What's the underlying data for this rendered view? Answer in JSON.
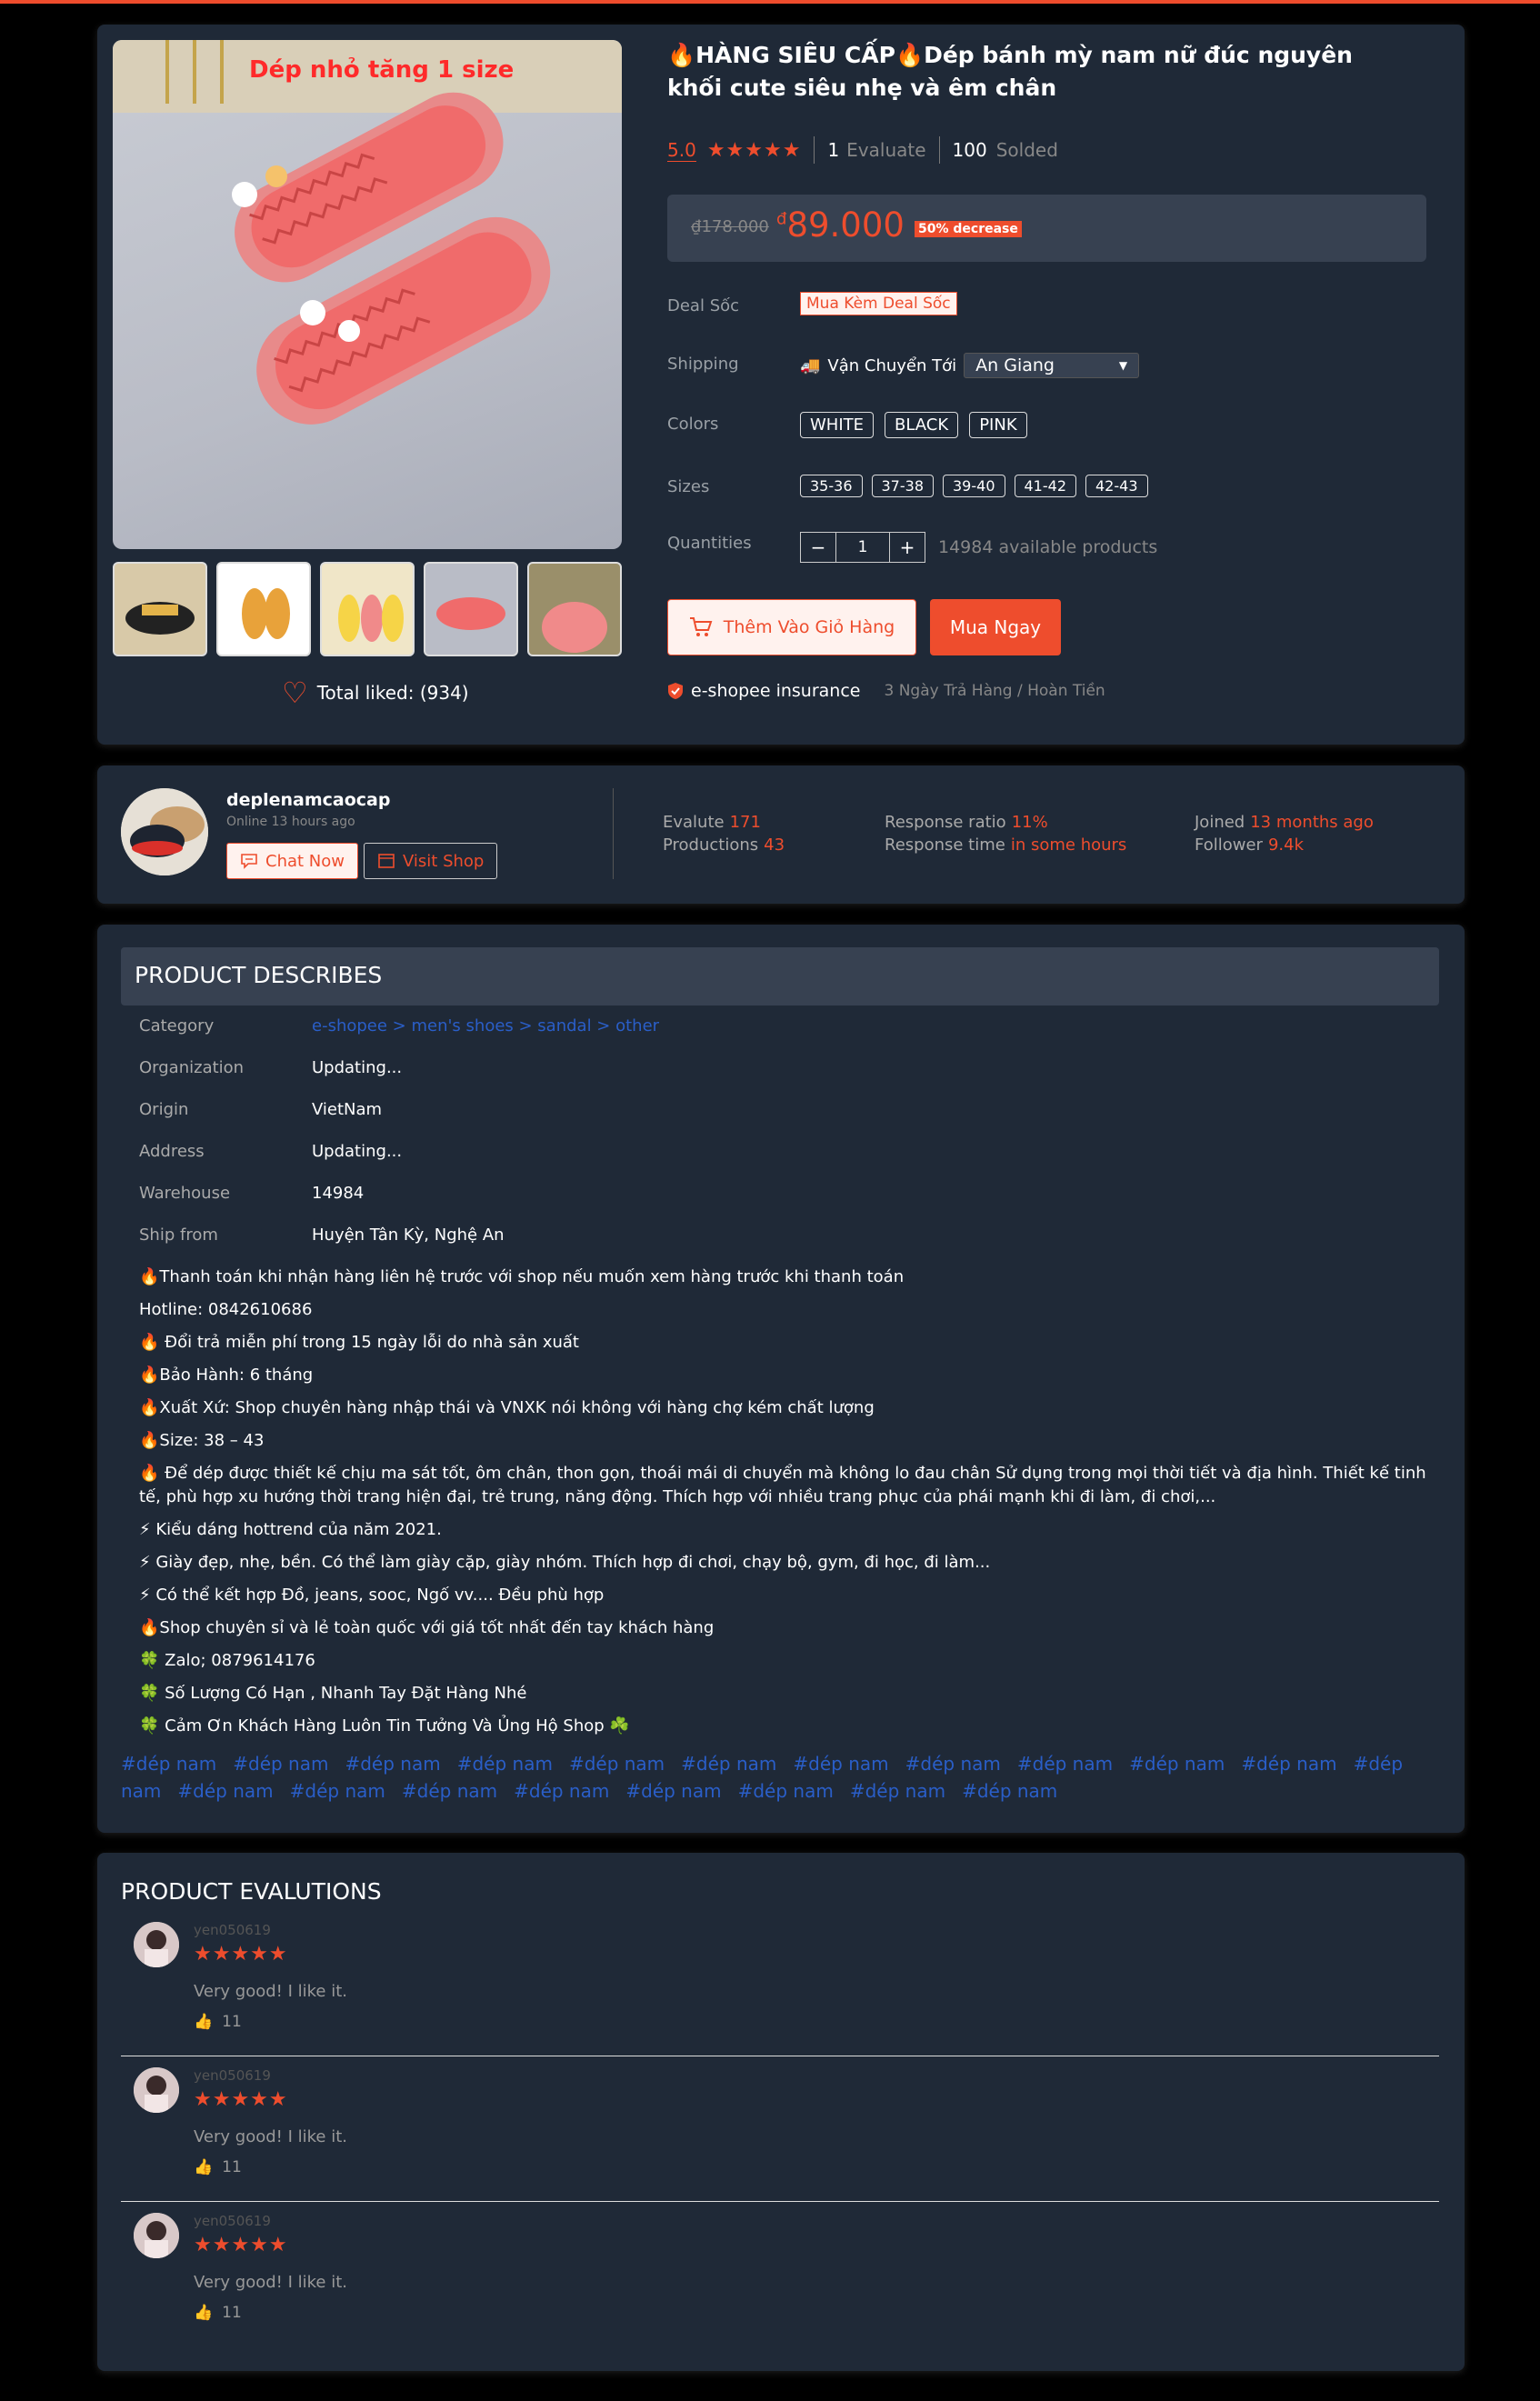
{
  "product": {
    "promo_text": "Dép nhỏ tăng 1 size",
    "liked_label": "Total liked: (934)",
    "title": "🔥HÀNG SIÊU CẤP🔥Dép bánh mỳ nam nữ đúc nguyên khối cute siêu nhẹ và êm chân",
    "rating": "5.0",
    "stars": "★★★★★",
    "evaluate_count": "1",
    "evaluate_label": "Evaluate",
    "sold_count": "100",
    "sold_label": "Solded",
    "old_price": "₫178.000",
    "currency": "đ",
    "price": "89.000",
    "discount": "50% decrease",
    "deal_label": "Deal Sốc",
    "deal_value": "Mua Kèm Deal Sốc",
    "shipping_label": "Shipping",
    "shipping_text": "Vận Chuyển Tới",
    "shipping_location": "An Giang",
    "colors_label": "Colors",
    "colors": [
      "WHITE",
      "BLACK",
      "PINK"
    ],
    "sizes_label": "Sizes",
    "sizes": [
      "35-36",
      "37-38",
      "39-40",
      "41-42",
      "42-43"
    ],
    "quantity_label": "Quantities",
    "quantity": "1",
    "available": "14984 available products",
    "add_to_cart": "Thêm Vào Giỏ Hàng",
    "buy_now": "Mua Ngay",
    "insurance": "e-shopee insurance",
    "return_policy": "3 Ngày Trả Hàng / Hoàn Tiền"
  },
  "shop": {
    "name": "deplenamcaocap",
    "online": "Online 13 hours ago",
    "chat": "Chat Now",
    "visit": "Visit Shop",
    "evalute_label": "Evalute",
    "evalute": "171",
    "productions_label": "Productions",
    "productions": "43",
    "response_ratio_label": "Response ratio",
    "response_ratio": "11%",
    "response_time_label": "Response time",
    "response_time": "in some hours",
    "joined_label": "Joined",
    "joined": "13 months ago",
    "follower_label": "Follower",
    "follower": "9.4k"
  },
  "description": {
    "header": "PRODUCT DESCRIBES",
    "specs": [
      {
        "key": "Category",
        "value": "e-shopee > men's shoes > sandal > other"
      },
      {
        "key": "Organization",
        "value": "Updating..."
      },
      {
        "key": "Origin",
        "value": "VietNam"
      },
      {
        "key": "Address",
        "value": "Updating..."
      },
      {
        "key": "Warehouse",
        "value": "14984"
      },
      {
        "key": "Ship from",
        "value": "Huyện Tân Kỳ, Nghệ An"
      }
    ],
    "lines": [
      "🔥Thanh toán khi nhận hàng liên hệ trước với shop nếu muốn xem hàng trước khi thanh toán",
      "Hotline: 0842610686",
      "🔥 Đổi trả miễn phí trong 15 ngày lỗi do nhà sản xuất",
      "🔥Bảo Hành: 6 tháng",
      "🔥Xuất Xứ: Shop chuyên hàng nhập thái và VNXK nói không với hàng chợ kém chất lượng",
      "🔥Size: 38 – 43",
      "🔥 Để dép được thiết kế chịu ma sát tốt, ôm chân, thon gọn, thoái mái di chuyển mà không lo đau chân Sử dụng trong mọi thời tiết và địa hình. Thiết kế tinh tế, phù hợp xu hướng thời trang hiện đại, trẻ trung, năng động. Thích hợp với nhiều trang phục của phái mạnh khi đi làm, đi chơi,...",
      "⚡ Kiểu dáng hottrend của năm 2021.",
      "⚡ Giày đẹp, nhẹ, bền. Có thể làm giày cặp, giày nhóm. Thích hợp đi chơi, chạy bộ, gym, đi học, đi làm...",
      "⚡ Có thể kết hợp Đồ, jeans, sooc, Ngố vv.... Đều phù hợp",
      "🔥Shop chuyên sỉ và lẻ toàn quốc với giá tốt nhất đến tay khách hàng",
      "🍀 Zalo; 0879614176",
      "🍀 Số Lượng Có Hạn , Nhanh Tay Đặt Hàng Nhé",
      "🍀 Cảm Ơn Khách Hàng Luôn Tin Tưởng Và Ủng Hộ Shop ☘️"
    ],
    "tags": [
      "#dép nam",
      "#dép nam",
      "#dép nam",
      "#dép nam",
      "#dép nam",
      "#dép nam",
      "#dép nam",
      "#dép nam",
      "#dép nam",
      "#dép nam",
      "#dép nam",
      "#dép nam",
      "#dép nam",
      "#dép nam",
      "#dép nam",
      "#dép nam",
      "#dép nam",
      "#dép nam",
      "#dép nam",
      "#dép nam"
    ]
  },
  "evaluations": {
    "header": "PRODUCT EVALUTIONS",
    "reviews": [
      {
        "user": "yen050619",
        "stars": "★★★★★",
        "comment": "Very good! I like it.",
        "likes": "11"
      },
      {
        "user": "yen050619",
        "stars": "★★★★★",
        "comment": "Very good! I like it.",
        "likes": "11"
      },
      {
        "user": "yen050619",
        "stars": "★★★★★",
        "comment": "Very good! I like it.",
        "likes": "11"
      }
    ]
  },
  "colors": {
    "accent": "#ee4d2d",
    "card": "#1f2937",
    "panel": "#374151",
    "link": "#2a5ec8"
  }
}
